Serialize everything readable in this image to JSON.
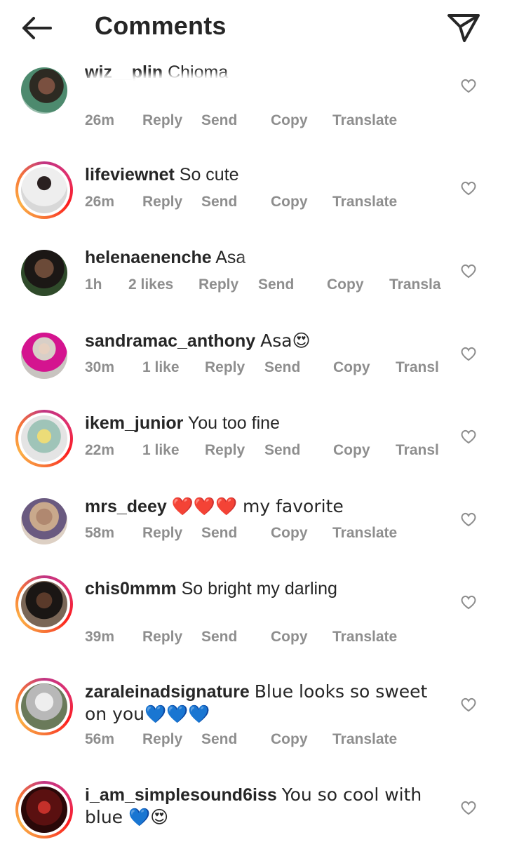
{
  "header": {
    "title": "Comments"
  },
  "actions": {
    "reply": "Reply",
    "send": "Send",
    "copy": "Copy",
    "translate": "Translate"
  },
  "comments": [
    {
      "user": "wiz__plin",
      "text": "Chioma",
      "time": "26m",
      "likes": "",
      "translate": "Translate"
    },
    {
      "user": "lifeviewnet",
      "text": "So cute",
      "time": "26m",
      "likes": "",
      "translate": "Translate"
    },
    {
      "user": "helenaenenche",
      "text": "Asa",
      "time": "1h",
      "likes": "2 likes",
      "translate": "Transla"
    },
    {
      "user": "sandramac_anthony",
      "text": "Asa😍",
      "time": "30m",
      "likes": "1 like",
      "translate": "Transl"
    },
    {
      "user": "ikem_junior",
      "text": "You too fine",
      "time": "22m",
      "likes": "1 like",
      "translate": "Transl"
    },
    {
      "user": "mrs_deey",
      "text": "❤️❤️❤️ my favorite",
      "time": "58m",
      "likes": "",
      "translate": "Translate"
    },
    {
      "user": "chis0mmm",
      "text": "So bright my darling",
      "time": "39m",
      "likes": "",
      "translate": "Translate"
    },
    {
      "user": "zaraleinadsignature",
      "text": "Blue looks so sweet on you💙💙💙",
      "time": "56m",
      "likes": "",
      "translate": "Translate"
    },
    {
      "user": "i_am_simplesound6iss",
      "text": "You so cool with blue 💙😍",
      "time": "",
      "likes": "",
      "translate": ""
    }
  ],
  "colors": {
    "text": "#262626",
    "meta": "#8e8e8e",
    "story_ring": [
      "#c13584",
      "#fd1d1d",
      "#fcaf45"
    ]
  },
  "icons": {
    "back": "arrow-left-icon",
    "send": "paper-plane-icon",
    "like": "heart-outline-icon"
  }
}
